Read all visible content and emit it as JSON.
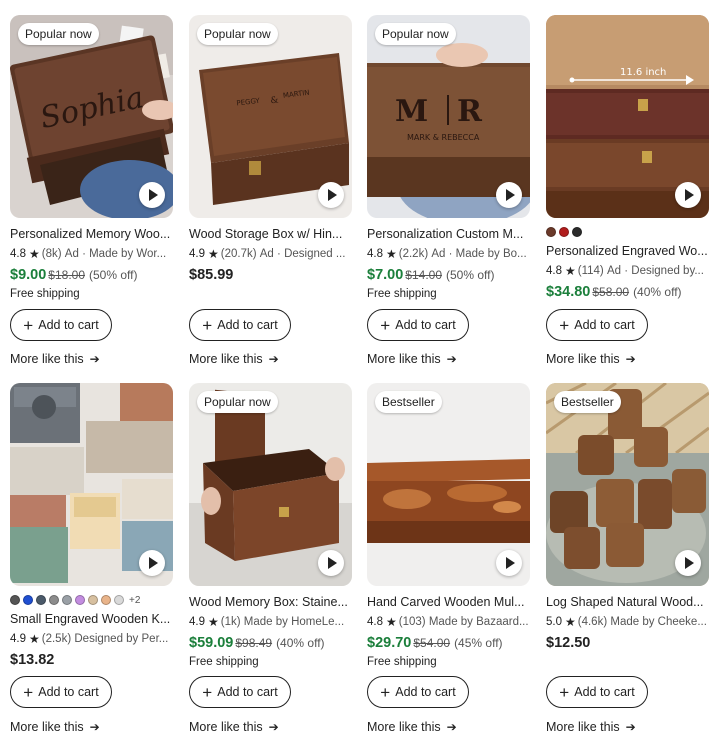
{
  "colors": {
    "sale": "#1b7f3b",
    "text": "#222222",
    "muted": "#555555"
  },
  "common": {
    "add_to_cart": "Add to cart",
    "more_like_this": "More like this",
    "star_icon": "star-icon",
    "play_icon": "play-icon"
  },
  "products": [
    {
      "badge": "Popular now",
      "title": "Personalized Memory Woo...",
      "rating": "4.8",
      "reviews": "(8k)",
      "ad": "Ad",
      "seller": "· Made by Wor...",
      "price": "$9.00",
      "original": "$18.00",
      "discount": "(50% off)",
      "shipping": "Free shipping",
      "engraving": "Sophia"
    },
    {
      "badge": "Popular now",
      "title": "Wood Storage Box w/ Hin...",
      "rating": "4.9",
      "reviews": "(20.7k)",
      "ad": "Ad",
      "seller": "· Designed ...",
      "price": "$85.99",
      "original": "",
      "discount": "",
      "shipping": "",
      "engraving_top": "PEGGY",
      "engraving_amp": "&",
      "engraving_bottom": "MARTIN"
    },
    {
      "badge": "Popular now",
      "title": "Personalization Custom M...",
      "rating": "4.8",
      "reviews": "(2.2k)",
      "ad": "Ad",
      "seller": "· Made by Bo...",
      "price": "$7.00",
      "original": "$14.00",
      "discount": "(50% off)",
      "shipping": "Free shipping",
      "engraving_left": "M",
      "engraving_right": "R",
      "engraving_names": "MARK & REBECCA"
    },
    {
      "badge": "",
      "title": "Personalized Engraved Wo...",
      "rating": "4.8",
      "reviews": "(114)",
      "ad": "Ad",
      "seller": "· Designed by...",
      "price": "$34.80",
      "original": "$58.00",
      "discount": "(40% off)",
      "shipping": "",
      "dimension": "11.6 inch",
      "swatches": [
        "#6b3a2a",
        "#b11d1d",
        "#2b2b2b"
      ],
      "more_swatches": ""
    },
    {
      "badge": "",
      "title": "Small Engraved Wooden K...",
      "rating": "4.9",
      "reviews": "(2.5k)",
      "ad": "",
      "seller": "Designed by Per...",
      "price": "$13.82",
      "original": "",
      "discount": "",
      "shipping": "",
      "swatches": [
        "#555555",
        "#1f4fd1",
        "#4b5a6a",
        "#8c8c8c",
        "#9aa0a6",
        "#c38de0",
        "#d7c0a0",
        "#e9b48a",
        "#d9d9d9"
      ],
      "more_swatches": "+2"
    },
    {
      "badge": "Popular now",
      "title": "Wood Memory Box: Staine...",
      "rating": "4.9",
      "reviews": "(1k)",
      "ad": "",
      "seller": "Made by HomeLe...",
      "price": "$59.09",
      "original": "$98.49",
      "discount": "(40% off)",
      "shipping": "Free shipping"
    },
    {
      "badge": "Bestseller",
      "title": "Hand Carved Wooden Mul...",
      "rating": "4.8",
      "reviews": "(103)",
      "ad": "",
      "seller": "Made by Bazaard...",
      "price": "$29.70",
      "original": "$54.00",
      "discount": "(45% off)",
      "shipping": "Free shipping"
    },
    {
      "badge": "Bestseller",
      "title": "Log Shaped Natural Wood...",
      "rating": "5.0",
      "reviews": "(4.6k)",
      "ad": "",
      "seller": "Made by Cheeke...",
      "price": "$12.50",
      "original": "",
      "discount": "",
      "shipping": ""
    }
  ]
}
